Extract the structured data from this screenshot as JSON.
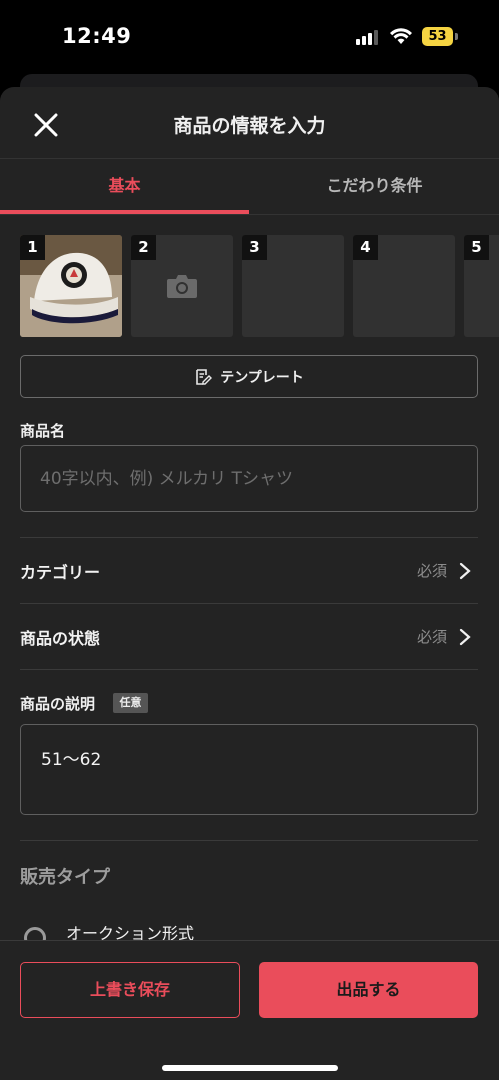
{
  "status_bar": {
    "time": "12:49",
    "battery": "53"
  },
  "header": {
    "title": "商品の情報を入力",
    "close_icon": "close-icon"
  },
  "tabs": [
    {
      "label": "基本",
      "active": true
    },
    {
      "label": "こだわり条件",
      "active": false
    }
  ],
  "photos": [
    {
      "number": "1",
      "filled": true
    },
    {
      "number": "2",
      "filled": false,
      "icon": "camera-icon"
    },
    {
      "number": "3",
      "filled": false
    },
    {
      "number": "4",
      "filled": false
    },
    {
      "number": "5",
      "filled": false
    }
  ],
  "template_button": {
    "label": "テンプレート",
    "icon": "template-edit-icon"
  },
  "product_name": {
    "label": "商品名",
    "placeholder": "40字以内、例) メルカリ Tシャツ",
    "value": ""
  },
  "category": {
    "label": "カテゴリー",
    "required": "必須"
  },
  "condition": {
    "label": "商品の状態",
    "required": "必須"
  },
  "description": {
    "label": "商品の説明",
    "badge": "任意",
    "value": "51〜62"
  },
  "sale_type": {
    "label": "販売タイプ",
    "options": [
      {
        "label": "オークション形式",
        "selected": false
      }
    ]
  },
  "footer": {
    "save_label": "上書き保存",
    "list_label": "出品する"
  },
  "colors": {
    "accent": "#ea4d5b",
    "background": "#232323"
  }
}
